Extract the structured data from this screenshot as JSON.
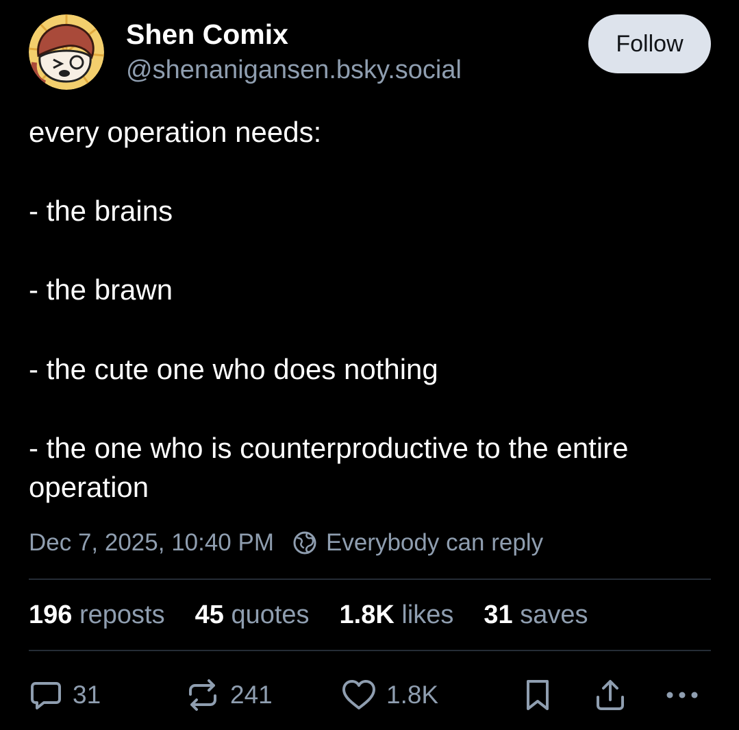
{
  "post": {
    "author_name": "Shen Comix",
    "author_handle": "@shenanigansen.bsky.social",
    "follow_label": "Follow",
    "text": "every operation needs:\n\n- the brains\n\n- the brawn\n\n- the cute one who does nothing\n\n- the one who is counterproductive to the entire operation",
    "timestamp": "Dec 7, 2025, 10:40 PM",
    "reply_setting": "Everybody can reply"
  },
  "stats": [
    {
      "value": "196",
      "label": "reposts"
    },
    {
      "value": "45",
      "label": "quotes"
    },
    {
      "value": "1.8K",
      "label": "likes"
    },
    {
      "value": "31",
      "label": "saves"
    }
  ],
  "actions": {
    "reply_count": "31",
    "repost_count": "241",
    "like_count": "1.8K"
  },
  "colors": {
    "background": "#000000",
    "text": "#ffffff",
    "muted_text": "#8f9eb0",
    "follow_button_bg": "#dde3ec",
    "divider": "#252c36"
  },
  "icons": [
    "avatar",
    "globe-icon",
    "reply-icon",
    "repost-icon",
    "like-icon",
    "bookmark-icon",
    "share-icon",
    "more-icon"
  ]
}
